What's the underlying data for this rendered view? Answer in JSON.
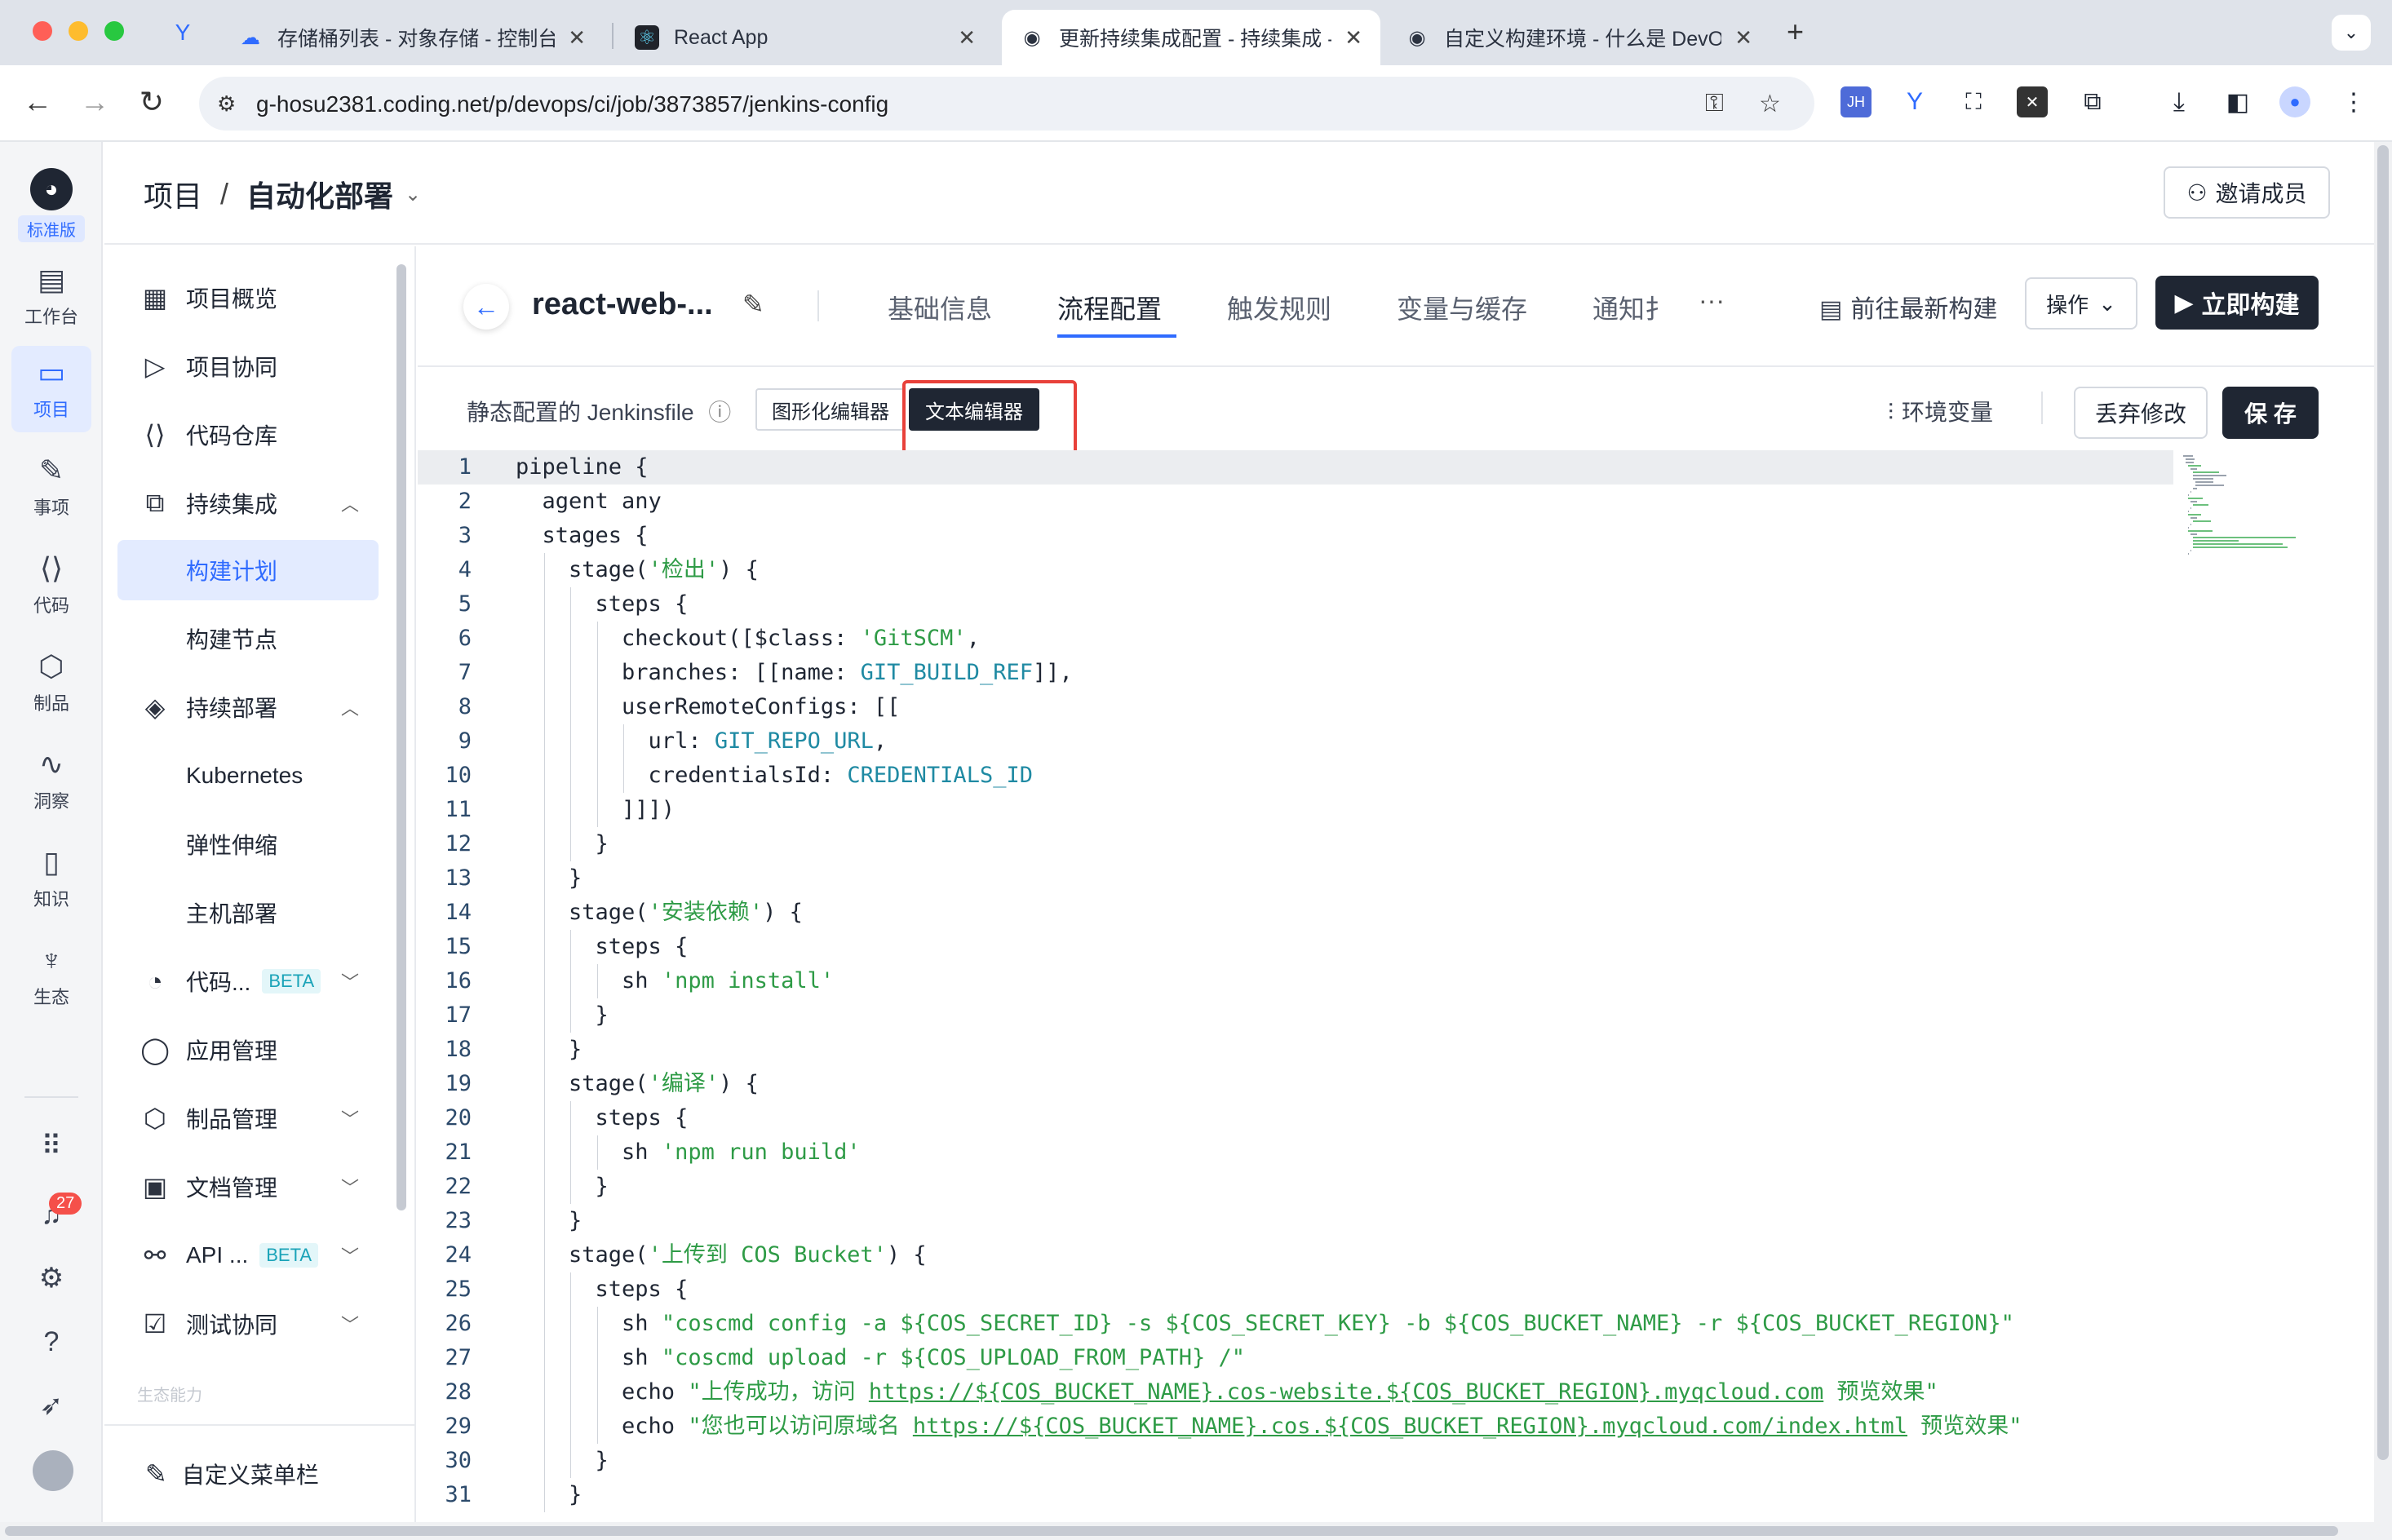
{
  "browser": {
    "tabs": [
      {
        "title": "存储桶列表 - 对象存储 - 控制台",
        "close": "✕"
      },
      {
        "title": "React App",
        "close": "✕"
      },
      {
        "title": "更新持续集成配置 - 持续集成 -",
        "close": "✕"
      },
      {
        "title": "自定义构建环境 - 什么是 DevO",
        "close": "✕"
      }
    ],
    "new_tab": "+",
    "url": "g-hosu2381.coding.net/p/devops/ci/job/3873857/jenkins-config",
    "ext_jh": "JH"
  },
  "rail": {
    "edition": "标准版",
    "items": [
      {
        "label": "工作台",
        "icon": "dashboard-icon"
      },
      {
        "label": "项目",
        "icon": "folder-icon"
      },
      {
        "label": "事项",
        "icon": "issue-icon"
      },
      {
        "label": "代码",
        "icon": "code-icon"
      },
      {
        "label": "制品",
        "icon": "package-icon"
      },
      {
        "label": "洞察",
        "icon": "insight-icon"
      },
      {
        "label": "知识",
        "icon": "book-icon"
      },
      {
        "label": "生态",
        "icon": "ecosystem-icon"
      }
    ],
    "notification_count": "27"
  },
  "header": {
    "crumb_root": "项目",
    "crumb_sep": "/",
    "crumb_current": "自动化部署",
    "invite_label": "邀请成员"
  },
  "menu": {
    "items": [
      {
        "label": "项目概览"
      },
      {
        "label": "项目协同"
      },
      {
        "label": "代码仓库"
      },
      {
        "label": "持续集成"
      },
      {
        "label": "构建计划"
      },
      {
        "label": "构建节点"
      },
      {
        "label": "持续部署"
      },
      {
        "label": "Kubernetes"
      },
      {
        "label": "弹性伸缩"
      },
      {
        "label": "主机部署"
      },
      {
        "label": "代码..."
      },
      {
        "label": "应用管理"
      },
      {
        "label": "制品管理"
      },
      {
        "label": "文档管理"
      },
      {
        "label": "API ..."
      },
      {
        "label": "测试协同"
      }
    ],
    "beta": "BETA",
    "faded": "生态能力",
    "footer": "自定义菜单栏"
  },
  "job": {
    "name": "react-web-...",
    "tabs": [
      "基础信息",
      "流程配置",
      "触发规则",
      "变量与缓存",
      "通知扌"
    ],
    "more": "···",
    "latest_build": "前往最新构建",
    "ops": "操作",
    "build_now": "立即构建"
  },
  "config": {
    "label": "静态配置的 Jenkinsfile",
    "graphic_editor": "图形化编辑器",
    "text_editor": "文本编辑器",
    "env_vars": "环境变量",
    "discard": "丢弃修改",
    "save": "保 存"
  },
  "code": {
    "lines": [
      "pipeline {",
      "  agent any",
      "  stages {",
      "    stage('检出') {",
      "      steps {",
      "        checkout([$class: 'GitSCM',",
      "        branches: [[name: GIT_BUILD_REF]],",
      "        userRemoteConfigs: [[",
      "          url: GIT_REPO_URL,",
      "          credentialsId: CREDENTIALS_ID",
      "        ]]])",
      "      }",
      "    }",
      "    stage('安装依赖') {",
      "      steps {",
      "        sh 'npm install'",
      "      }",
      "    }",
      "    stage('编译') {",
      "      steps {",
      "        sh 'npm run build'",
      "      }",
      "    }",
      "    stage('上传到 COS Bucket') {",
      "      steps {",
      "        sh \"coscmd config -a ${COS_SECRET_ID} -s ${COS_SECRET_KEY} -b ${COS_BUCKET_NAME} -r ${COS_BUCKET_REGION}\"",
      "        sh \"coscmd upload -r ${COS_UPLOAD_FROM_PATH} /\"",
      "        echo \"上传成功，访问 https://${COS_BUCKET_NAME}.cos-website.${COS_BUCKET_REGION}.myqcloud.com 预览效果\"",
      "        echo \"您也可以访问原域名 https://${COS_BUCKET_NAME}.cos.${COS_BUCKET_REGION}.myqcloud.com/index.html 预览效果\"",
      "      }",
      "    }"
    ]
  },
  "colors": {
    "accent": "#2f6bff",
    "dark_button": "#1f2633",
    "string": "#2e9b46",
    "identifier": "#1f8aa3",
    "highlight_box": "#e8413a"
  }
}
